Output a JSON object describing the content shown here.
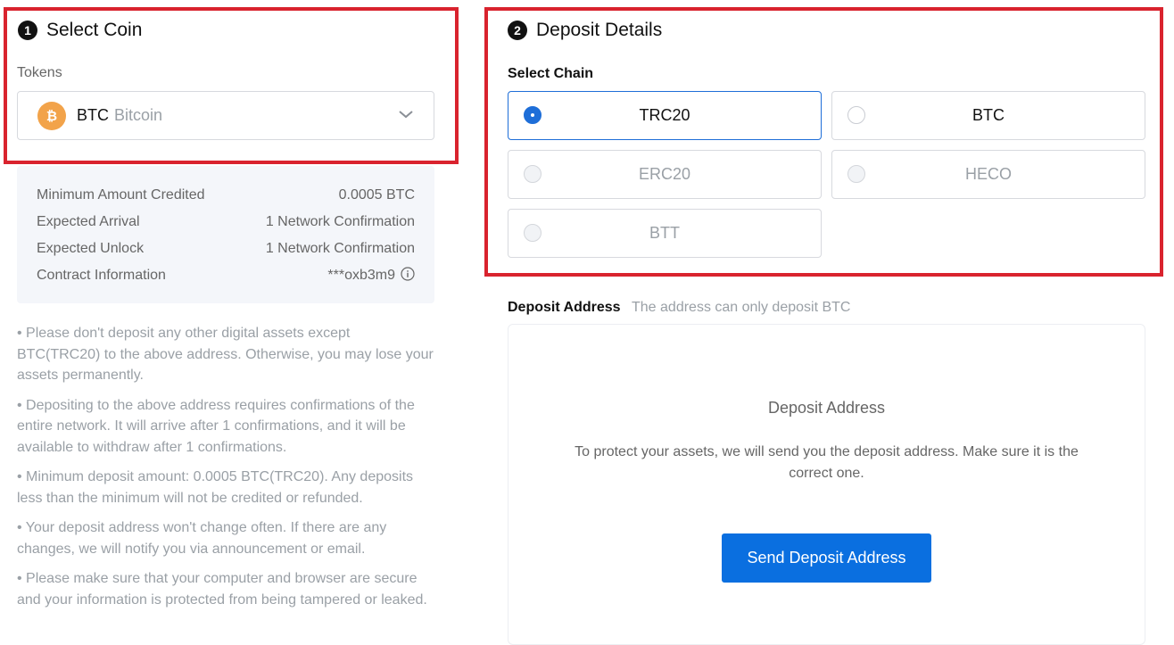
{
  "select_coin": {
    "step_number": "1",
    "title": "Select Coin",
    "tokens_label": "Tokens",
    "selected_token": {
      "code": "BTC",
      "name": "Bitcoin",
      "icon": "bitcoin-icon",
      "icon_color": "#f2a34a"
    }
  },
  "info": [
    {
      "label": "Minimum Amount Credited",
      "value": "0.0005 BTC"
    },
    {
      "label": "Expected Arrival",
      "value": "1 Network Confirmation"
    },
    {
      "label": "Expected Unlock",
      "value": "1 Network Confirmation"
    },
    {
      "label": "Contract Information",
      "value": "***oxb3m9"
    }
  ],
  "notes": [
    "• Please don't deposit any other digital assets except BTC(TRC20) to the above address. Otherwise, you may lose your assets permanently.",
    "• Depositing to the above address requires confirmations of the entire network. It will arrive after 1 confirmations, and it will be available to withdraw after 1 confirmations.",
    "• Minimum deposit amount: 0.0005 BTC(TRC20). Any deposits less than the minimum will not be credited or refunded.",
    "• Your deposit address won't change often. If there are any changes, we will notify you via announcement or email.",
    "• Please make sure that your computer and browser are secure and your information is protected from being tampered or leaked."
  ],
  "deposit_details": {
    "step_number": "2",
    "title": "Deposit Details",
    "select_chain_label": "Select Chain",
    "chains": [
      {
        "label": "TRC20",
        "selected": true,
        "enabled": true
      },
      {
        "label": "BTC",
        "selected": false,
        "enabled": true
      },
      {
        "label": "ERC20",
        "selected": false,
        "enabled": false
      },
      {
        "label": "HECO",
        "selected": false,
        "enabled": false
      },
      {
        "label": "BTT",
        "selected": false,
        "enabled": false
      }
    ]
  },
  "deposit_address": {
    "label": "Deposit Address",
    "hint": "The address can only deposit BTC",
    "card_title": "Deposit Address",
    "card_text": "To protect your assets, we will send you the deposit address. Make sure it is the correct one.",
    "button_label": "Send Deposit Address"
  },
  "colors": {
    "highlight_frame": "#d9232e",
    "accent_blue": "#0a6fe0",
    "muted_text": "#9aa0a6"
  }
}
